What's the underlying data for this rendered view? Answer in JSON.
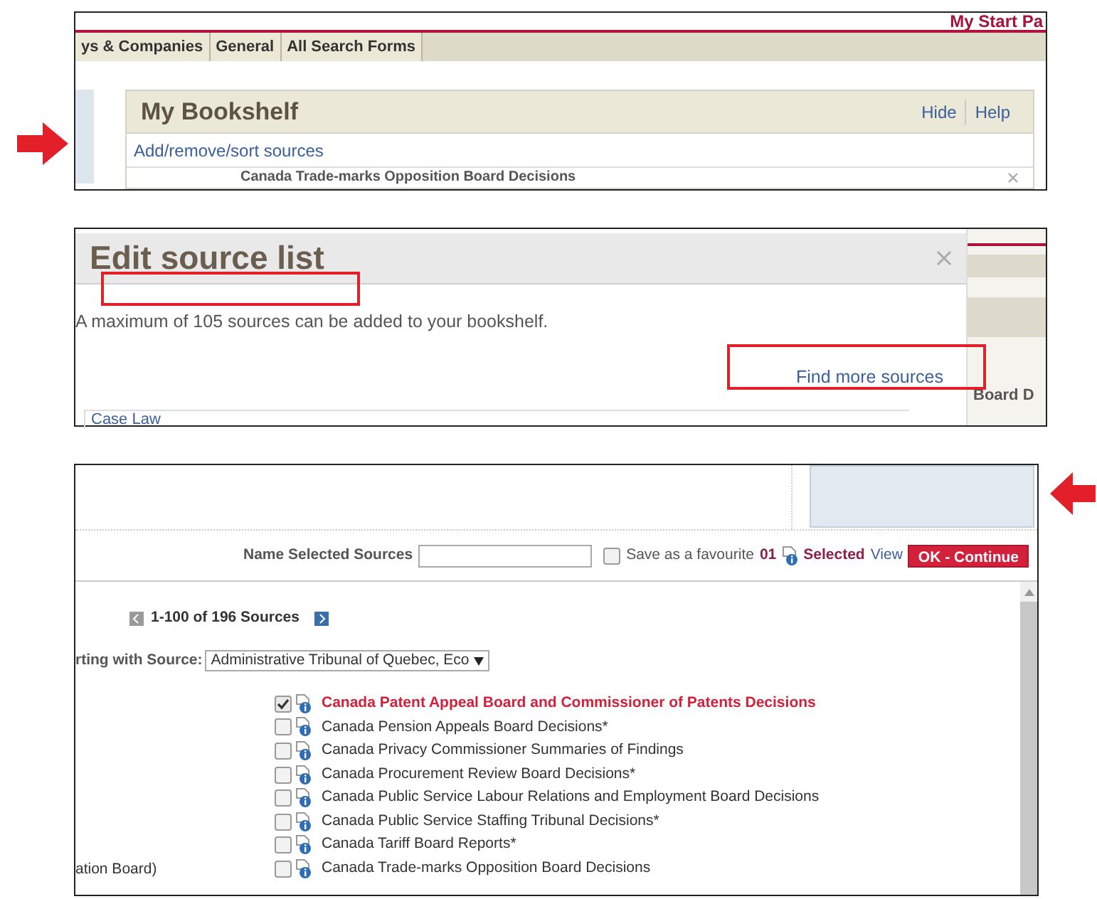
{
  "panel_1": {
    "top_link": "My Start Pa",
    "tabs": [
      "ys & Companies",
      "General",
      "All Search Forms"
    ],
    "bookshelf": {
      "title": "My Bookshelf",
      "links": [
        "Hide",
        "Help"
      ],
      "add_link": "Add/remove/sort sources",
      "first_source": "Canada Trade-marks Opposition Board Decisions"
    }
  },
  "panel_2": {
    "title": "Edit source list",
    "note": "A maximum of 105 sources can be added to your bookshelf.",
    "find_more": "Find more sources",
    "tab": "Case Law",
    "behind_text": "Board D"
  },
  "panel_3": {
    "name_label": "Name Selected Sources",
    "favourite": {
      "label": "Save as a favourite",
      "checked": false
    },
    "selected_count": "01",
    "selected_label": "Selected",
    "view_link": "View",
    "ok_button": "OK - Continue",
    "pagination": "1-100 of 196 Sources",
    "start_label": "rting with Source:",
    "start_select": "Administrative Tribunal of Quebec, Eco",
    "left_text": "ation Board)",
    "sources": [
      {
        "name": "Canada Patent Appeal Board and Commissioner of Patents Decisions",
        "checked": true
      },
      {
        "name": "Canada Pension Appeals Board Decisions*",
        "checked": false
      },
      {
        "name": "Canada Privacy Commissioner Summaries of Findings",
        "checked": false
      },
      {
        "name": "Canada Procurement Review Board Decisions*",
        "checked": false
      },
      {
        "name": "Canada Public Service Labour Relations and Employment Board Decisions",
        "checked": false
      },
      {
        "name": "Canada Public Service Staffing Tribunal Decisions*",
        "checked": false
      },
      {
        "name": "Canada Tariff Board Reports*",
        "checked": false
      },
      {
        "name": "Canada Trade-marks Opposition Board Decisions",
        "checked": false
      }
    ]
  }
}
